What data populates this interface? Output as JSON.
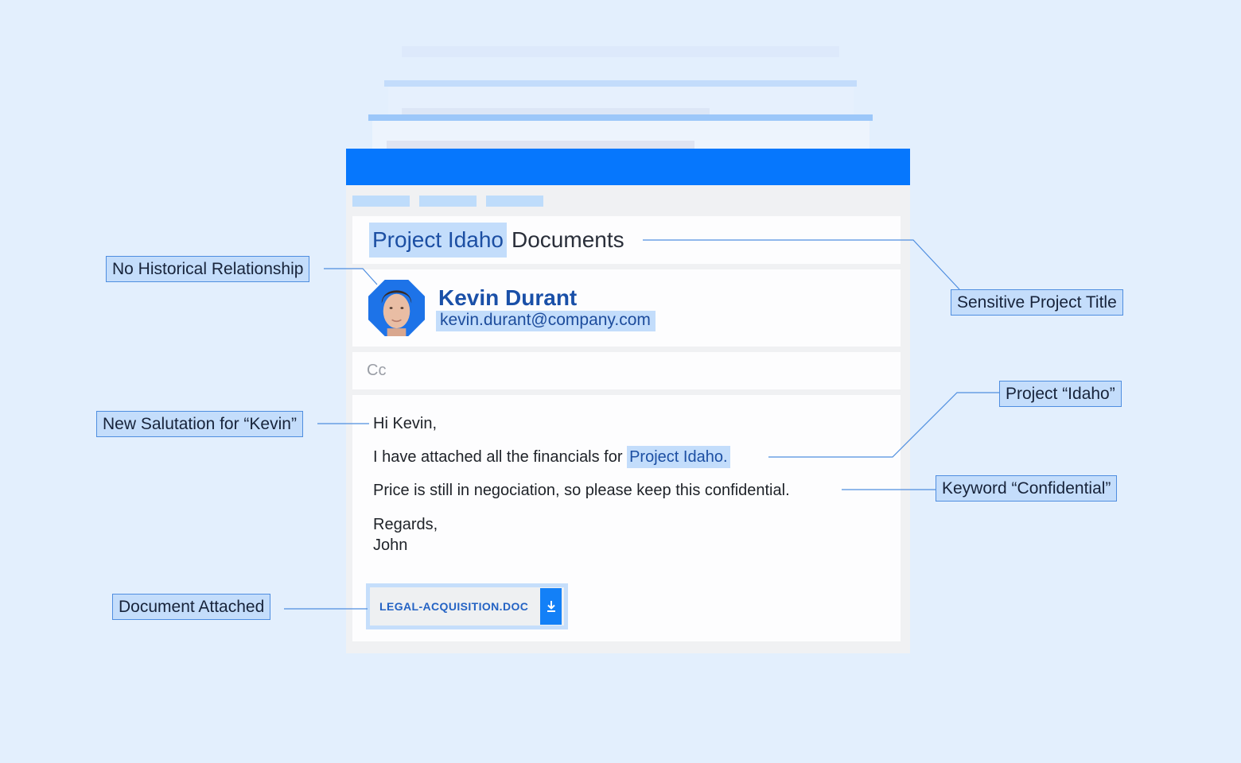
{
  "email": {
    "subject_highlight": "Project Idaho",
    "subject_rest": "Documents",
    "contact_name": "Kevin Durant",
    "contact_email": "kevin.durant@company.com",
    "cc_label": "Cc",
    "greeting": "Hi Kevin,",
    "line1_before": "I have attached all the financials for ",
    "line1_highlight": "Project Idaho.",
    "line2": "Price is still in negociation, so please keep this confidential.",
    "closing": "Regards,",
    "signature": "John",
    "attachment_name": "LEGAL-ACQUISITION.DOC",
    "attachment_icon": "download-icon"
  },
  "callouts": {
    "no_history": "No Historical Relationship",
    "sensitive_title": "Sensitive Project Title",
    "salutation": "New Salutation for “Kevin”",
    "project_idaho": "Project “Idaho”",
    "keyword_confidential": "Keyword “Confidential”",
    "document_attached": "Document Attached"
  },
  "colors": {
    "background": "#e3effd",
    "titlebar": "#0677fd",
    "highlight": "#c3ddfb",
    "callout_border": "#4f8ee0"
  }
}
